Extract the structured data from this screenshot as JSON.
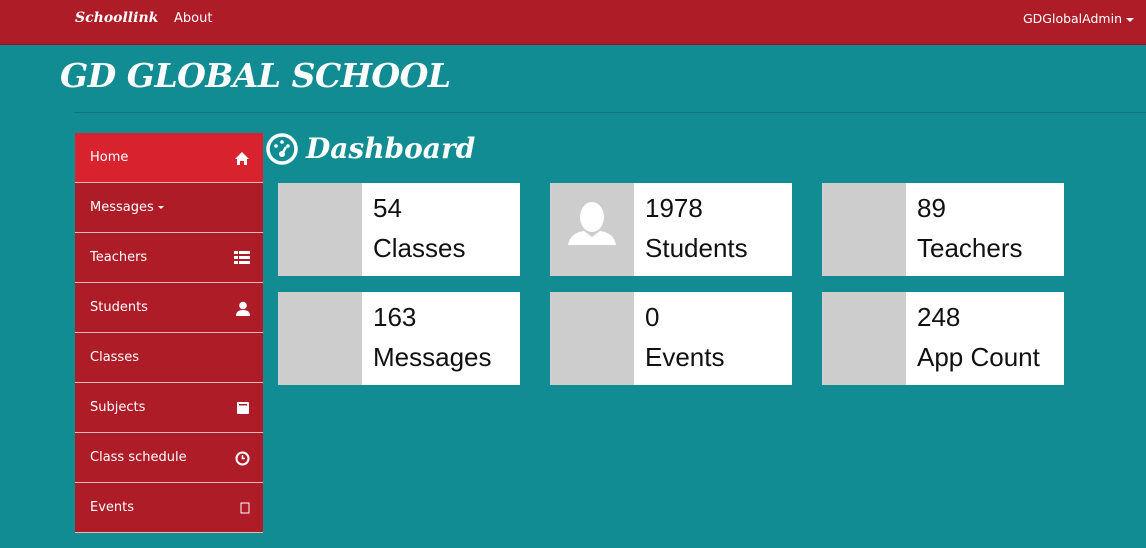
{
  "navbar": {
    "brand": "Schoollink",
    "about": "About",
    "user": "GDGlobalAdmin"
  },
  "school_name": "GD GLOBAL SCHOOL",
  "dashboard_title": "Dashboard",
  "sidebar": {
    "items": [
      {
        "label": "Home",
        "icon": "home-icon"
      },
      {
        "label": "Messages",
        "icon": "caret-down-icon"
      },
      {
        "label": "Teachers",
        "icon": "list-icon"
      },
      {
        "label": "Students",
        "icon": "user-icon"
      },
      {
        "label": "Classes",
        "icon": ""
      },
      {
        "label": "Subjects",
        "icon": "book-icon"
      },
      {
        "label": "Class schedule",
        "icon": "clock-icon"
      },
      {
        "label": "Events",
        "icon": "calendar-icon"
      }
    ]
  },
  "cards": [
    {
      "value": "54",
      "label": "Classes"
    },
    {
      "value": "1978",
      "label": "Students"
    },
    {
      "value": "89",
      "label": "Teachers"
    },
    {
      "value": "163",
      "label": "Messages"
    },
    {
      "value": "0",
      "label": "Events"
    },
    {
      "value": "248",
      "label": "App Count"
    }
  ],
  "colors": {
    "nav": "#ae1c27",
    "active": "#d8232f",
    "background": "#118c92"
  }
}
